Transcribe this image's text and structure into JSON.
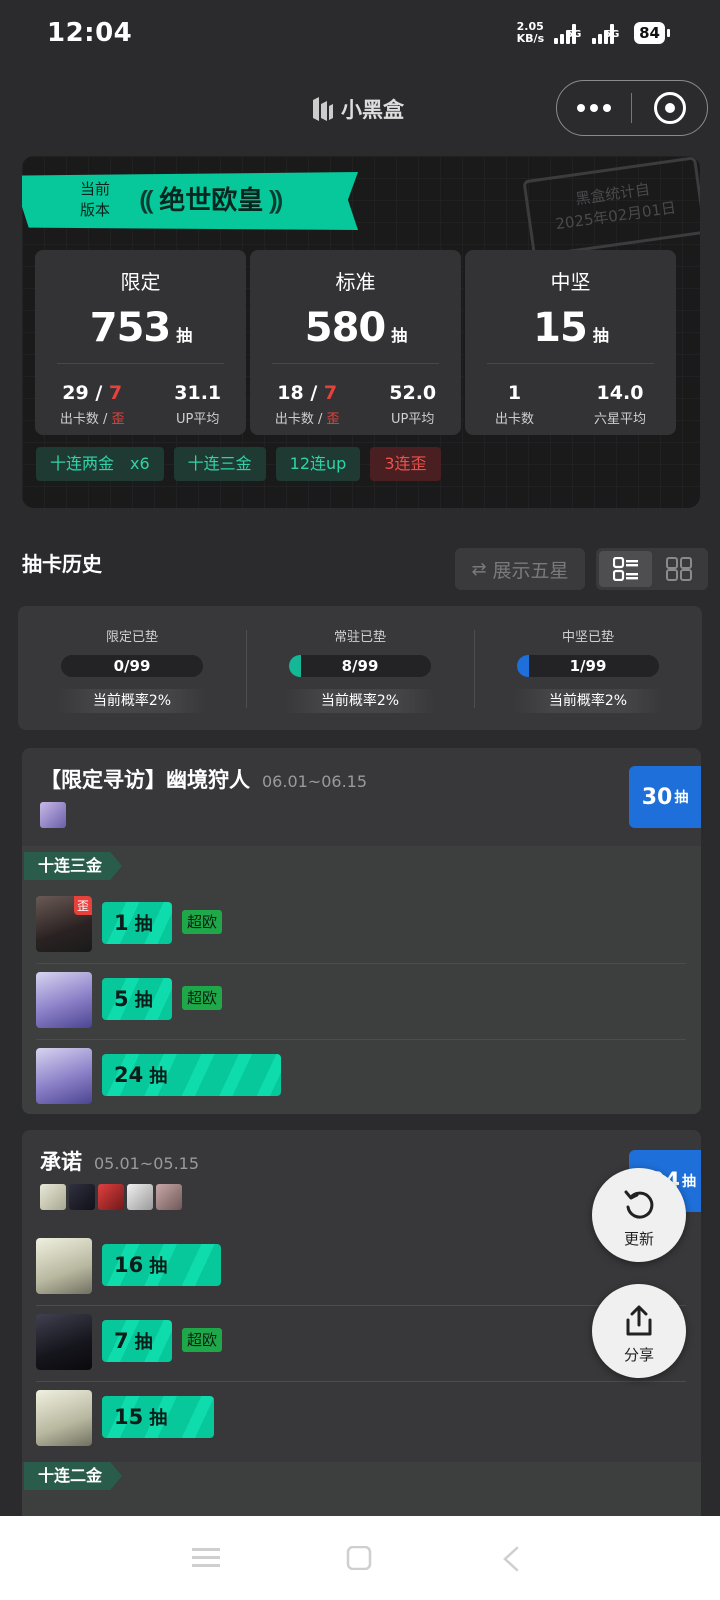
{
  "status": {
    "time": "12:04",
    "net_speed_top": "2.05",
    "net_speed_bottom": "KB/s",
    "sim1": "5G",
    "sim2": "5G",
    "battery": "84"
  },
  "topbar": {
    "app_name": "小黑盒"
  },
  "summary": {
    "version_label_1": "当前",
    "version_label_2": "版本",
    "title": "绝世欧皇",
    "stamp_line1": "黑盒统计自",
    "stamp_line2": "2025年02月01日",
    "cards": [
      {
        "category": "限定",
        "total": "753",
        "unit": "抽",
        "a_value": "29",
        "a_slash": " / ",
        "a_red": "7",
        "a_label": "出卡数 / ",
        "a_label_red": "歪",
        "b_value": "31.1",
        "b_label": "UP平均"
      },
      {
        "category": "标准",
        "total": "580",
        "unit": "抽",
        "a_value": "18",
        "a_slash": " / ",
        "a_red": "7",
        "a_label": "出卡数 / ",
        "a_label_red": "歪",
        "b_value": "52.0",
        "b_label": "UP平均"
      },
      {
        "category": "中坚",
        "total": "15",
        "unit": "抽",
        "a_value": "1",
        "a_slash": "",
        "a_red": "",
        "a_label": "出卡数",
        "a_label_red": "",
        "b_value": "14.0",
        "b_label": "六星平均"
      }
    ],
    "tags": [
      "十连两金　x6",
      "十连三金",
      "12连up",
      "3连歪"
    ]
  },
  "history": {
    "title": "抽卡历史",
    "toggle_label": "展示五星"
  },
  "pity": [
    {
      "label": "已垫",
      "prefix": "限定",
      "value": "0/99",
      "fraction": 0.0,
      "prob": "当前概率2%"
    },
    {
      "label": "已垫",
      "prefix": "常驻",
      "value": "8/99",
      "fraction": 0.081,
      "prob": "当前概率2%"
    },
    {
      "label": "已垫",
      "prefix": "中坚",
      "value": "1/99",
      "fraction": 0.01,
      "prob": "当前概率2%"
    }
  ],
  "events": [
    {
      "title": "【限定寻访】幽境狩人",
      "dates": "06.01~06.15",
      "count": "30",
      "count_unit": "抽",
      "ribbon": "十连三金",
      "pulls": [
        {
          "n": "1",
          "unit": "抽",
          "badge": "超欧",
          "wai": "歪",
          "fraction": 0.04
        },
        {
          "n": "5",
          "unit": "抽",
          "badge": "超欧",
          "wai": "",
          "fraction": 0.2
        },
        {
          "n": "24",
          "unit": "抽",
          "badge": "",
          "wai": "",
          "fraction": 0.96
        }
      ]
    },
    {
      "title": "承诺",
      "dates": "05.01~05.15",
      "count": "204",
      "count_unit": "抽",
      "ribbon": "十连二金",
      "pulls": [
        {
          "n": "16",
          "unit": "抽",
          "badge": "",
          "wai": "",
          "fraction": 0.64
        },
        {
          "n": "7",
          "unit": "抽",
          "badge": "超欧",
          "wai": "",
          "fraction": 0.28
        },
        {
          "n": "15",
          "unit": "抽",
          "badge": "",
          "wai": "",
          "fraction": 0.6
        }
      ]
    }
  ],
  "fab": {
    "refresh": "更新",
    "share": "分享"
  },
  "colors": {
    "accent": "#06c89a",
    "blue": "#1e6fd9",
    "red": "#e8413c",
    "lucky": "#1fa84a"
  }
}
